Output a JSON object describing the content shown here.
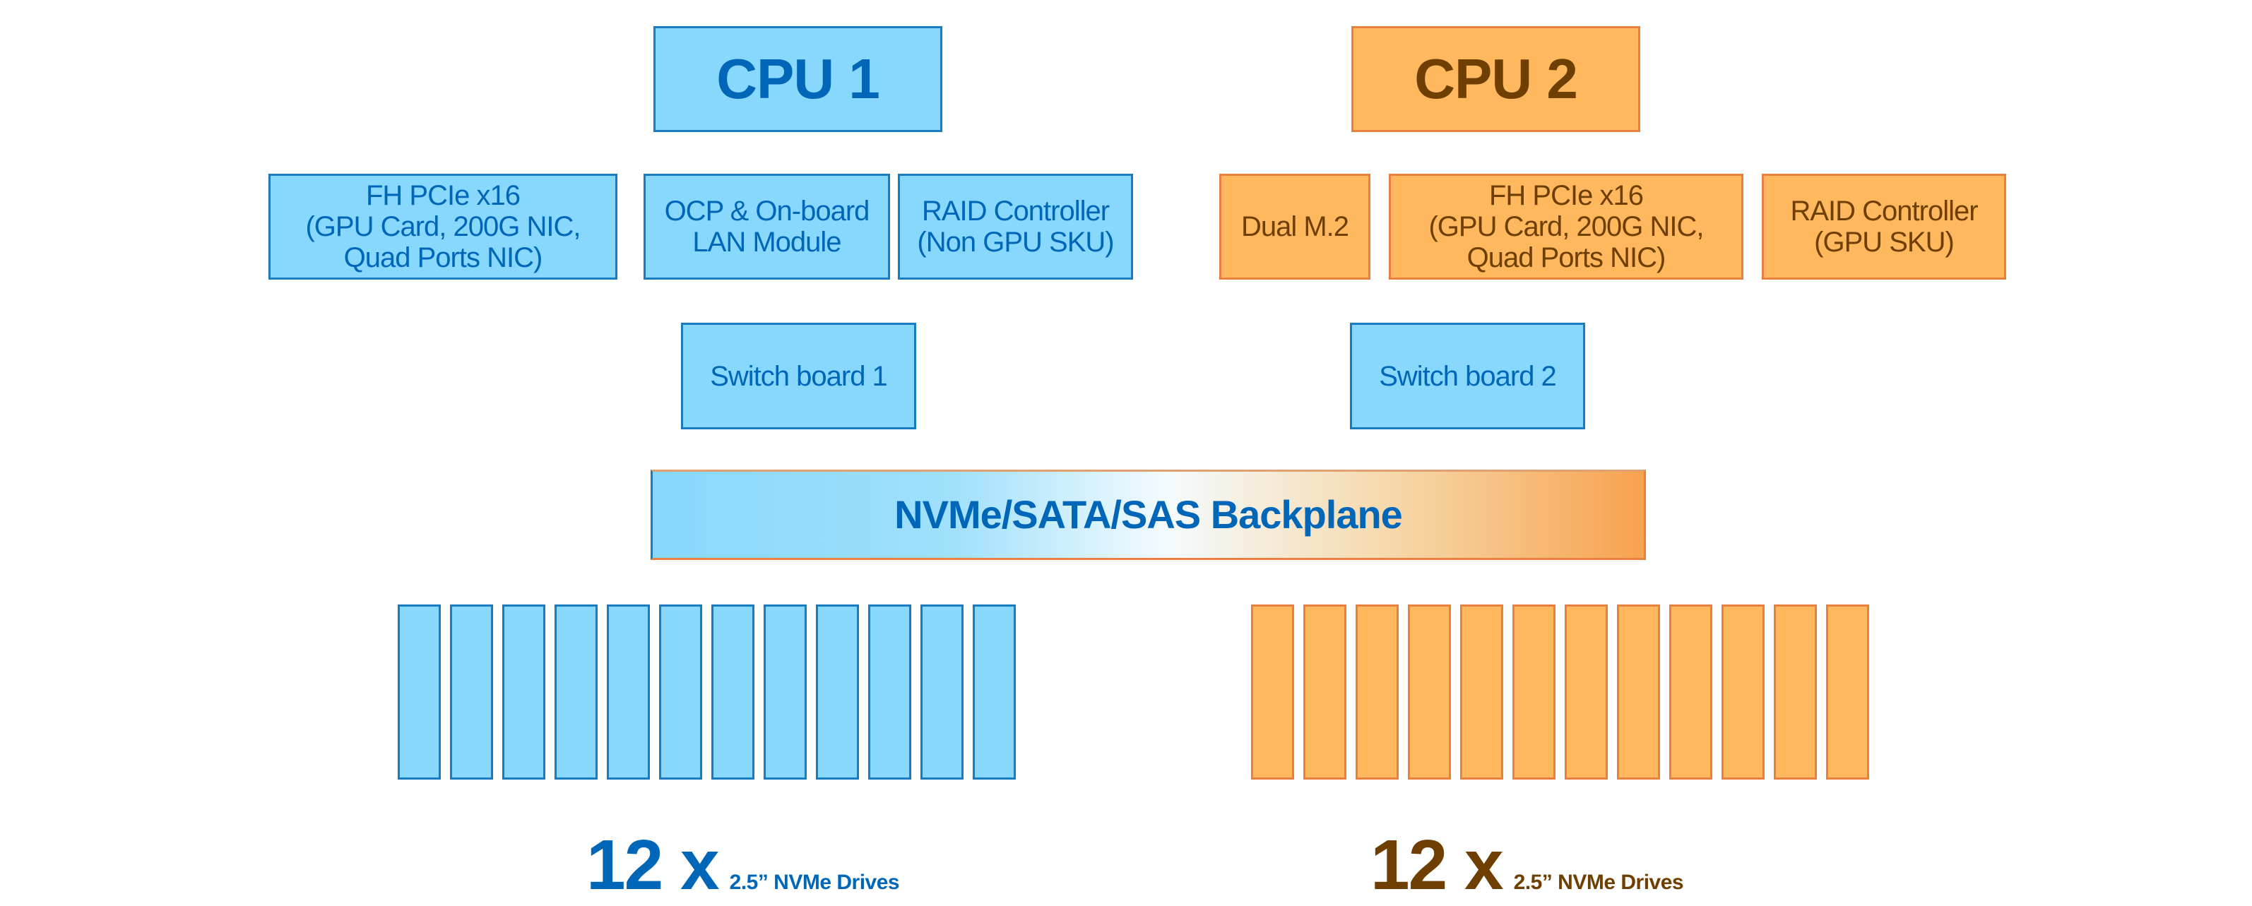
{
  "colors": {
    "cpu1_fill": "#87d8fc",
    "cpu1_text": "#0066b8",
    "cpu2_fill": "#ffb85e",
    "cpu2_text": "#6e3f00"
  },
  "cpu1": {
    "title": "CPU 1",
    "modules": [
      {
        "lines": [
          "FH PCIe x16",
          "(GPU Card, 200G NIC,",
          "Quad Ports NIC)"
        ]
      },
      {
        "lines": [
          "OCP & On-board",
          "LAN Module"
        ]
      },
      {
        "lines": [
          "RAID Controller",
          "(Non GPU SKU)"
        ]
      }
    ],
    "switch": "Switch board 1",
    "drives_count": "12 x",
    "drives_desc": "2.5” NVMe Drives"
  },
  "cpu2": {
    "title": "CPU 2",
    "modules": [
      {
        "lines": [
          "Dual M.2"
        ]
      },
      {
        "lines": [
          "FH PCIe x16",
          "(GPU Card, 200G NIC,",
          "Quad Ports NIC)"
        ]
      },
      {
        "lines": [
          "RAID Controller",
          "(GPU SKU)"
        ]
      }
    ],
    "switch": "Switch board 2",
    "drives_count": "12 x",
    "drives_desc": "2.5” NVMe Drives"
  },
  "backplane": "NVMe/SATA/SAS Backplane",
  "drives_per_side": 12
}
